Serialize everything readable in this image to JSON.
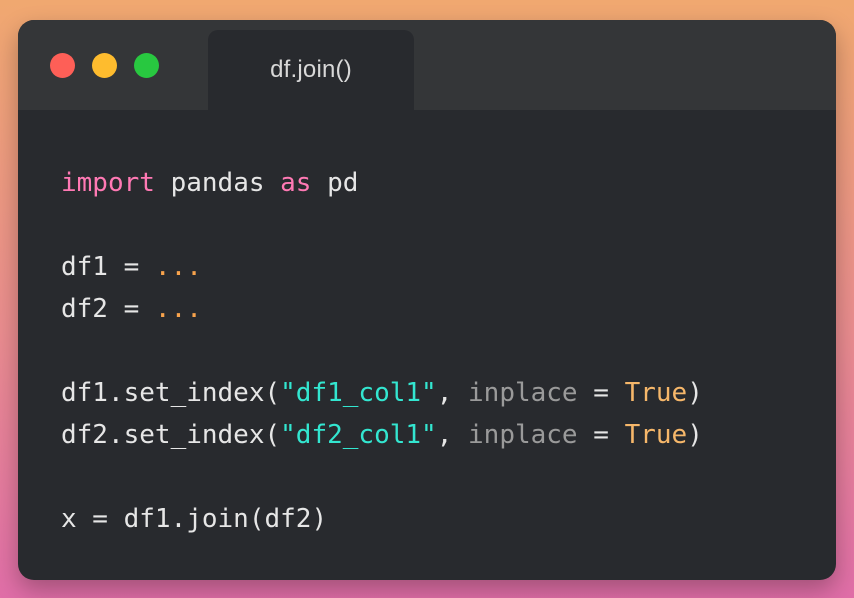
{
  "window": {
    "tab_title": "df.join()",
    "buttons": [
      "close",
      "minimize",
      "maximize"
    ]
  },
  "colors": {
    "keyword": "#ff79b4",
    "ellipsis": "#f8a34c",
    "string": "#33e6d0",
    "parameter": "#9a9a9a",
    "boolean": "#f6b76a",
    "text": "#e6e6e6",
    "editor_bg": "#282a2e",
    "titlebar_bg": "#343638"
  },
  "code": {
    "line1": {
      "kw1": "import",
      "t1": " pandas ",
      "kw2": "as",
      "t2": " pd"
    },
    "line3": {
      "t1": "df1 = ",
      "ell": "..."
    },
    "line4": {
      "t1": "df2 = ",
      "ell": "..."
    },
    "line6": {
      "t1": "df1.set_index(",
      "str": "\"df1_col1\"",
      "t2": ", ",
      "param": "inplace",
      "t3": " = ",
      "bool": "True",
      "t4": ")"
    },
    "line7": {
      "t1": "df2.set_index(",
      "str": "\"df2_col1\"",
      "t2": ", ",
      "param": "inplace",
      "t3": " = ",
      "bool": "True",
      "t4": ")"
    },
    "line9": {
      "t1": "x = df1.join(df2)"
    }
  }
}
